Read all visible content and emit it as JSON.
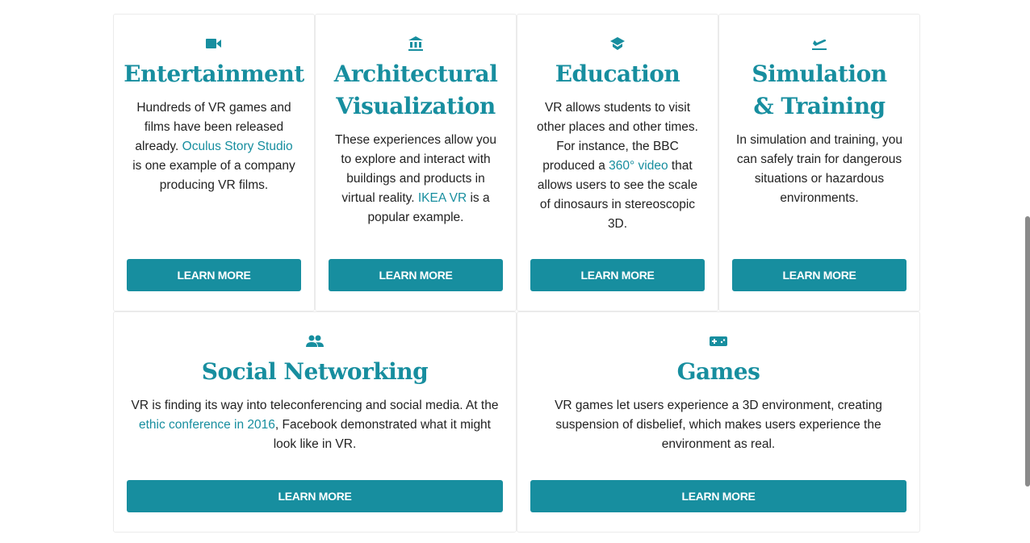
{
  "accent": "#178e9f",
  "cards": [
    {
      "icon": "video-camera-icon",
      "title": "Entertainment",
      "pre": "Hundreds of VR games and films have been released already. ",
      "link": "Oculus Story Studio",
      "post": " is one example of a company producing VR films.",
      "button": "LEARN MORE"
    },
    {
      "icon": "bank-building-icon",
      "title": "Architectural Visualization",
      "pre": "These experiences allow you to explore and interact with buildings and products in virtual reality. ",
      "link": "IKEA VR",
      "post": " is a popular example.",
      "button": "LEARN MORE"
    },
    {
      "icon": "graduation-cap-icon",
      "title": "Education",
      "pre": "VR allows students to visit other places and other times. For instance, the BBC produced a ",
      "link": "360° video",
      "post": " that allows users to see the scale of dinosaurs in stereoscopic 3D.",
      "button": "LEARN MORE"
    },
    {
      "icon": "flight-takeoff-icon",
      "title": "Simulation & Training",
      "pre": "In simulation and training, you can safely train for dangerous situations or hazardous environments.",
      "link": "",
      "post": "",
      "button": "LEARN MORE"
    },
    {
      "icon": "people-icon",
      "title": "Social Networking",
      "pre": "VR is finding its way into teleconferencing and social media. At the ",
      "link": "ethic conference in 2016",
      "post": ", Facebook demonstrated what it might look like in VR.",
      "button": "LEARN MORE"
    },
    {
      "icon": "gamepad-icon",
      "title": "Games",
      "pre": "VR games let users experience a 3D environment, creating suspension of disbelief, which makes users experience the environment as real.",
      "link": "",
      "post": "",
      "button": "LEARN MORE"
    }
  ]
}
